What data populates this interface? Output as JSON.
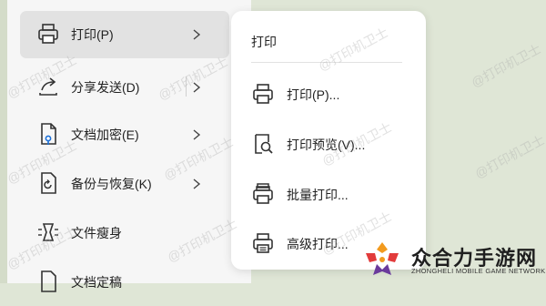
{
  "menu": {
    "items": [
      {
        "label": "打印(P)",
        "icon": "printer-icon",
        "has_submenu": true,
        "active": true
      },
      {
        "label": "分享发送(D)",
        "icon": "share-icon",
        "has_submenu": true
      },
      {
        "label": "文档加密(E)",
        "icon": "document-lock-icon",
        "has_submenu": true
      },
      {
        "label": "备份与恢复(K)",
        "icon": "backup-restore-icon",
        "has_submenu": true
      },
      {
        "label": "文件瘦身",
        "icon": "file-slim-icon",
        "has_submenu": false
      },
      {
        "label": "文档定稿",
        "icon": "document-finalize-icon",
        "has_submenu": false
      }
    ]
  },
  "submenu": {
    "title": "打印",
    "items": [
      {
        "label": "打印(P)...",
        "icon": "printer-icon"
      },
      {
        "label": "打印预览(V)...",
        "icon": "print-preview-icon"
      },
      {
        "label": "批量打印...",
        "icon": "batch-print-icon"
      },
      {
        "label": "高级打印...",
        "icon": "advanced-print-icon"
      }
    ]
  },
  "watermark": "@打印机卫士",
  "brand": {
    "name": "众合力手游网",
    "subtitle": "ZHONGHELI MOBILE GAME NETWORK",
    "colors": {
      "orange": "#f29a1e",
      "red": "#e23b3b",
      "purple": "#6a3a9c"
    }
  }
}
